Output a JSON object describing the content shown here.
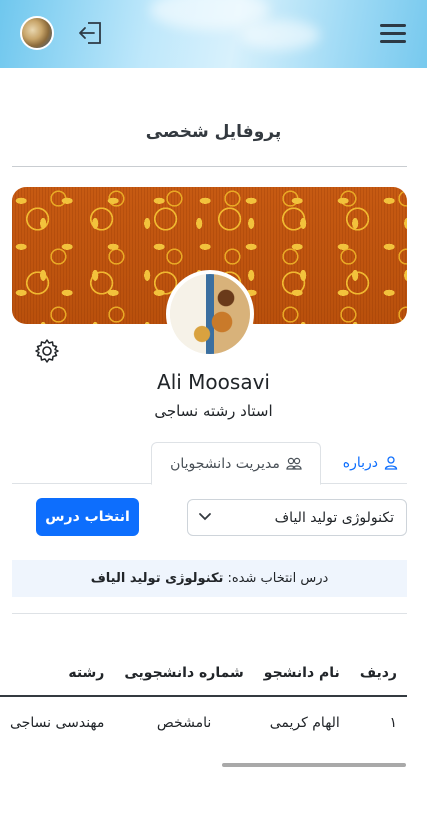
{
  "header": {
    "avatar_alt": "",
    "logout_icon": "logout-icon",
    "menu_icon": "hamburger-icon"
  },
  "page": {
    "title": "پروفایل شخصی"
  },
  "profile": {
    "name": "Ali Moosavi",
    "role": "استاد رشته نساجی",
    "settings_icon": "gear-icon"
  },
  "tabs": [
    {
      "label": "درباره",
      "icon": "user-icon",
      "active": false
    },
    {
      "label": "مدیریت دانشجویان",
      "icon": "users-icon",
      "active": true
    }
  ],
  "course": {
    "selected": "تکنولوژی تولید الیاف",
    "button_label": "انتخاب درس",
    "info_prefix": "درس انتخاب شده:",
    "info_value": "تکنولوژی تولید الیاف"
  },
  "table": {
    "headers": [
      "ردیف",
      "نام دانشجو",
      "شماره دانشجویی",
      "رشته"
    ],
    "rows": [
      [
        "۱",
        "الهام کریمی",
        "نامشخص",
        "مهندسی نساجی"
      ]
    ]
  },
  "colors": {
    "primary": "#0d6efd",
    "info_bg": "#eff5fd"
  }
}
